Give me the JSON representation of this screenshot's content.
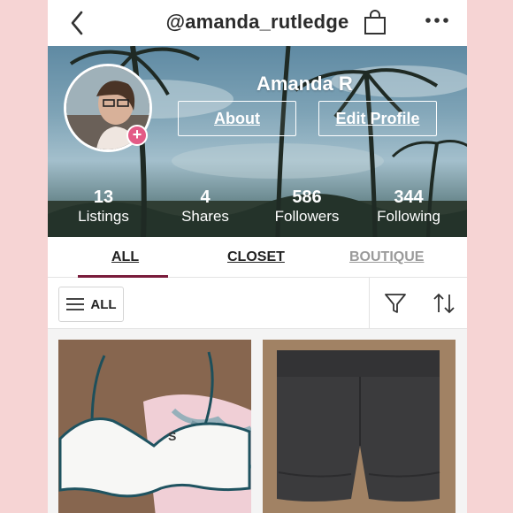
{
  "header": {
    "handle": "@amanda_rutledge",
    "icons": [
      "chevron-left-icon",
      "shopping-bag-icon",
      "more-horizontal-icon"
    ]
  },
  "profile": {
    "name": "Amanda R",
    "about_label": "About",
    "edit_profile_label": "Edit Profile",
    "avatar_badge": "+",
    "stats": [
      {
        "value": "13",
        "label": "Listings"
      },
      {
        "value": "4",
        "label": "Shares"
      },
      {
        "value": "586",
        "label": "Followers"
      },
      {
        "value": "344",
        "label": "Following"
      }
    ]
  },
  "tabs": [
    {
      "label": "ALL",
      "active": true
    },
    {
      "label": "CLOSET",
      "active": false
    },
    {
      "label": "BOUTIQUE",
      "active": false
    }
  ],
  "filter": {
    "all_label": "ALL",
    "icons": [
      "menu-icon",
      "filter-icon",
      "sort-icon"
    ]
  },
  "listings": [
    {
      "image": "bikini-top-photo"
    },
    {
      "image": "black-shorts-photo"
    }
  ],
  "colors": {
    "page_background": "#f6d4d4",
    "accent": "#7a1c3b",
    "badge": "#e35a86",
    "inactive_tab": "#9a9a9a"
  }
}
